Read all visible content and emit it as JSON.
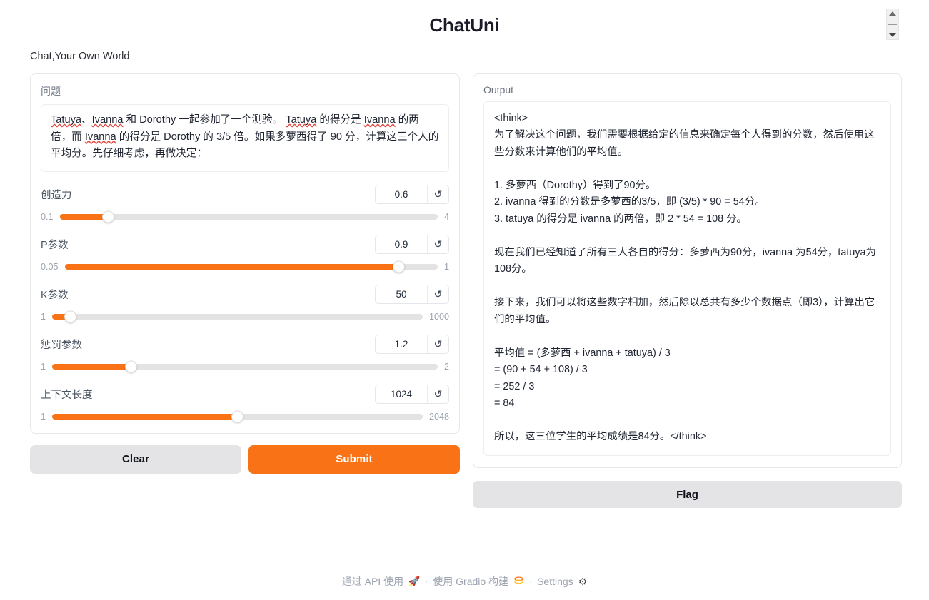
{
  "app": {
    "title": "ChatUni",
    "subtitle": "Chat,Your Own World",
    "accent_color": "#f97316",
    "track_color": "#e3e3e3",
    "button_secondary_color": "#e4e4e7"
  },
  "stepper": {
    "up_icon": "triangle-up-icon",
    "down_icon": "triangle-down-icon"
  },
  "input_panel": {
    "question": {
      "label": "问题",
      "value": "Tatuya、Ivanna 和 Dorothy 一起参加了一个测验。 Tatuya 的得分是 Ivanna 的两倍，而 Ivanna 的得分是 Dorothy 的 3/5 倍。如果多萝西得了 90 分，计算这三个人的平均分。先仔细考虑，再做决定："
    },
    "sliders": [
      {
        "label": "创造力",
        "value": "0.6",
        "min_label": "0.1",
        "max_label": "4",
        "min": 0.1,
        "max": 4,
        "current": 0.6,
        "fill_percent": 12.8,
        "reset_icon": "reset-icon"
      },
      {
        "label": "P参数",
        "value": "0.9",
        "min_label": "0.05",
        "max_label": "1",
        "min": 0.05,
        "max": 1,
        "current": 0.9,
        "fill_percent": 89.5,
        "reset_icon": "reset-icon"
      },
      {
        "label": "K参数",
        "value": "50",
        "min_label": "1",
        "max_label": "1000",
        "min": 1,
        "max": 1000,
        "current": 50,
        "fill_percent": 4.9,
        "reset_icon": "reset-icon"
      },
      {
        "label": "惩罚参数",
        "value": "1.2",
        "min_label": "1",
        "max_label": "2",
        "min": 1,
        "max": 2,
        "current": 1.2,
        "fill_percent": 20.5,
        "reset_icon": "reset-icon"
      },
      {
        "label": "上下文长度",
        "value": "1024",
        "min_label": "1",
        "max_label": "2048",
        "min": 1,
        "max": 2048,
        "current": 1024,
        "fill_percent": 50.0,
        "reset_icon": "reset-icon"
      }
    ],
    "buttons": {
      "clear": "Clear",
      "submit": "Submit"
    }
  },
  "output_panel": {
    "label": "Output",
    "text": "<think>\n为了解决这个问题，我们需要根据给定的信息来确定每个人得到的分数，然后使用这些分数来计算他们的平均值。\n\n1. 多萝西（Dorothy）得到了90分。\n2. ivanna 得到的分数是多萝西的3/5，即 (3/5) * 90 = 54分。\n3. tatuya 的得分是 ivanna 的两倍，即 2 * 54 = 108 分。\n\n现在我们已经知道了所有三人各自的得分：多萝西为90分，ivanna 为54分，tatuya为108分。\n\n接下来，我们可以将这些数字相加，然后除以总共有多少个数据点（即3），计算出它们的平均值。\n\n平均值 = (多萝西 + ivanna + tatuya) / 3\n= (90 + 54 + 108) / 3\n= 252 / 3\n= 84\n\n所以，这三位学生的平均成绩是84分。</think>",
    "flag_button": "Flag"
  },
  "footer": {
    "api_text": "通过 API 使用",
    "rocket_icon": "🚀",
    "separator": "·",
    "gradio_text": "使用 Gradio 构建",
    "gradio_icon": "gradio-logo-icon",
    "settings_text": "Settings",
    "settings_icon": "gear-icon"
  }
}
